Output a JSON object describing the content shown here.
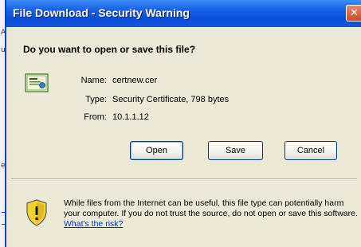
{
  "window": {
    "title": "File Download - Security Warning",
    "close_glyph": "✕"
  },
  "dialog": {
    "question": "Do you want to open or save this file?",
    "file_icon": "certificate-file-icon",
    "name_label": "Name:",
    "name_value": "certnew.cer",
    "type_label": "Type:",
    "type_value": "Security Certificate, 798 bytes",
    "from_label": "From:",
    "from_value": "10.1.1.12"
  },
  "buttons": {
    "open": "Open",
    "save": "Save",
    "cancel": "Cancel"
  },
  "warning": {
    "icon": "shield-warning-icon",
    "text": "While files from the Internet can be useful, this file type can potentially harm your computer. If you do not trust the source, do not open or save this software.",
    "link": "What's the risk?"
  },
  "background": {
    "chars": [
      "A",
      "u",
      "e"
    ]
  },
  "colors": {
    "titlebar": "#0b4ed8",
    "dialog_bg": "#ece9d8",
    "close_button": "#c94a2a",
    "link": "#0033cc",
    "button_border": "#003c74"
  }
}
